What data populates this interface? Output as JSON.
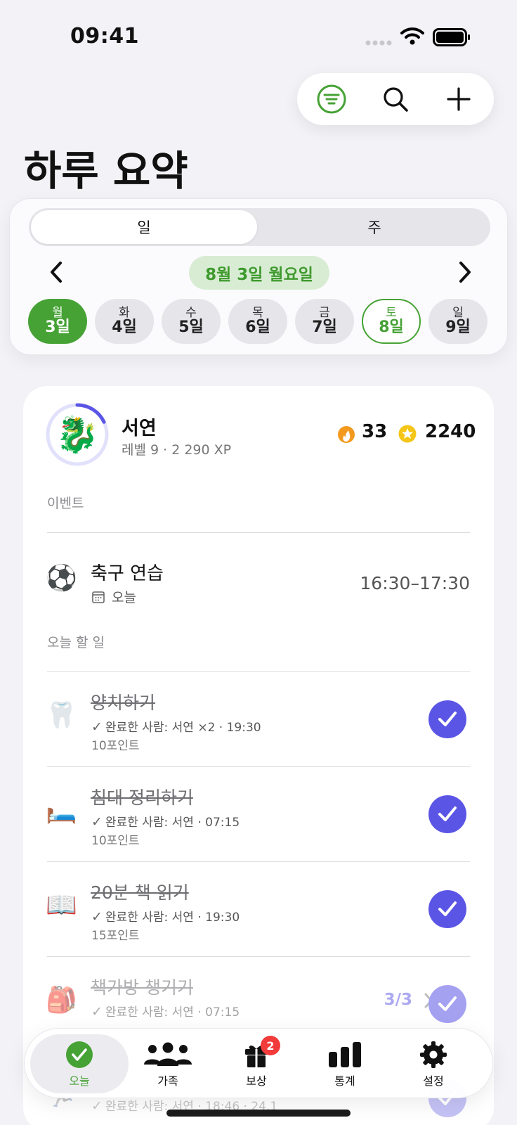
{
  "status_bar": {
    "time": "09:41"
  },
  "page": {
    "title": "하루 요약"
  },
  "date_picker": {
    "segments": {
      "day": "일",
      "week": "주"
    },
    "current_date": "8월 3일 월요일",
    "days": [
      {
        "weekday": "월",
        "date": "3일",
        "state": "selected"
      },
      {
        "weekday": "화",
        "date": "4일",
        "state": "normal"
      },
      {
        "weekday": "수",
        "date": "5일",
        "state": "normal"
      },
      {
        "weekday": "목",
        "date": "6일",
        "state": "normal"
      },
      {
        "weekday": "금",
        "date": "7일",
        "state": "normal"
      },
      {
        "weekday": "토",
        "date": "8일",
        "state": "today"
      },
      {
        "weekday": "일",
        "date": "9일",
        "state": "normal"
      }
    ]
  },
  "profile": {
    "name": "서연",
    "level_text": "레벨 9 · 2 290 XP",
    "level_progress": 0.18,
    "streak": "33",
    "coins": "2240"
  },
  "events_section": {
    "label": "이벤트",
    "items": [
      {
        "icon": "soccer-ball",
        "emoji": "⚽",
        "title": "축구 연습",
        "when": "오늘",
        "time": "16:30–17:30"
      }
    ]
  },
  "tasks_section": {
    "label": "오늘 할 일",
    "items": [
      {
        "emoji": "🦷",
        "icon": "tooth",
        "title": "양치하기",
        "done_text": "완료한 사람: 서연 ×2 · 19:30",
        "points": "10포인트",
        "completed": true
      },
      {
        "emoji": "🛏️",
        "icon": "bed",
        "title": "침대 정리하기",
        "done_text": "완료한 사람: 서연 · 07:15",
        "points": "10포인트",
        "completed": true
      },
      {
        "emoji": "📖",
        "icon": "open-book",
        "title": "20분 책 읽기",
        "done_text": "완료한 사람: 서연 · 19:30",
        "points": "15포인트",
        "completed": true
      },
      {
        "emoji": "🎒",
        "icon": "backpack",
        "title": "책가방 챙기기",
        "done_text": "완료한 사람: 서연 · 07:15",
        "points": "",
        "progress": "3/3",
        "completed": true
      },
      {
        "emoji": "🏃",
        "icon": "runner",
        "title": "",
        "done_text": "완료한 사람: 서연 · 18:46 · 24,1",
        "points": "",
        "completed": true
      }
    ]
  },
  "tab_bar": {
    "tabs": [
      {
        "label": "오늘",
        "icon": "check-circle-icon",
        "active": true
      },
      {
        "label": "가족",
        "icon": "people-icon",
        "active": false
      },
      {
        "label": "보상",
        "icon": "gift-icon",
        "active": false,
        "badge": "2"
      },
      {
        "label": "통계",
        "icon": "bar-chart-icon",
        "active": false
      },
      {
        "label": "설정",
        "icon": "gear-icon",
        "active": false
      }
    ]
  },
  "colors": {
    "accent_green": "#46a235",
    "accent_purple": "#5b55e6",
    "background": "#f2f2f7"
  }
}
